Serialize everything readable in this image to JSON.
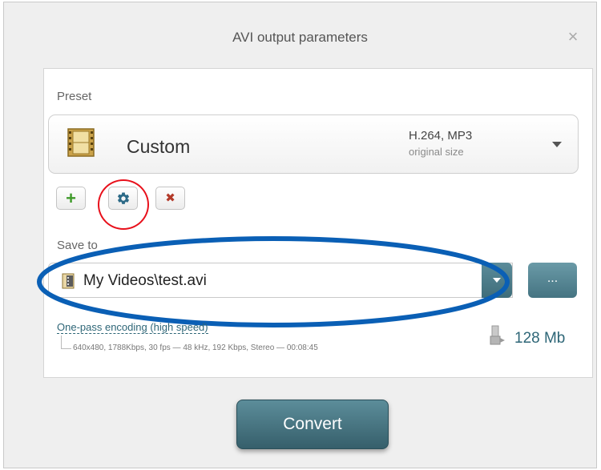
{
  "dialog": {
    "title": "AVI output parameters",
    "close_symbol": "×"
  },
  "preset": {
    "label": "Preset",
    "name": "Custom",
    "codec": "H.264, MP3",
    "size": "original size",
    "icon": "film-icon"
  },
  "preset_actions": {
    "add_symbol": "+",
    "settings_icon": "gear-icon",
    "delete_symbol": "✖"
  },
  "save": {
    "label": "Save to",
    "path": "My Videos\\test.avi",
    "browse_label": "..."
  },
  "encoding": {
    "mode": "One-pass encoding (high speed)",
    "details": "640x480, 1788Kbps, 30 fps — 48 kHz, 192 Kbps, Stereo — 00:08:45"
  },
  "output": {
    "size": "128 Mb"
  },
  "convert_label": "Convert",
  "colors": {
    "accent": "#45737f",
    "link": "#2e6677",
    "highlight_red": "#e8101b",
    "highlight_blue": "#0a5fb5",
    "add_green": "#3f9a2a",
    "delete_red": "#b33a2a"
  }
}
